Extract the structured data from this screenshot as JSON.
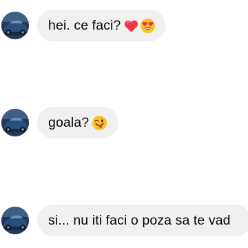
{
  "messages": [
    {
      "text": "hei. ce faci?",
      "emojis": [
        "red-heart-icon",
        "heart-eyes-emoji-icon"
      ]
    },
    {
      "text": "goala?",
      "emojis": [
        "winking-tongue-emoji-icon"
      ]
    },
    {
      "text": "si... nu iti faci o poza sa te vad",
      "emojis": []
    }
  ],
  "colors": {
    "bubble": "#f0f0f0",
    "text": "#050505",
    "heart": "#f0354b",
    "emoji_face": "#fbc02d"
  }
}
